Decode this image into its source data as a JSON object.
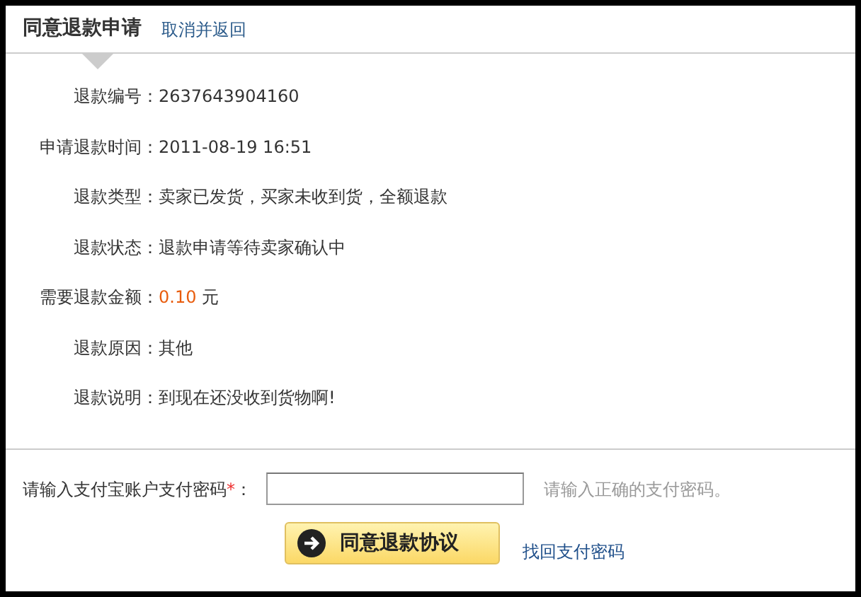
{
  "header": {
    "title": "同意退款申请",
    "link": "取消并返回"
  },
  "details": [
    {
      "label": "退款编号：",
      "value": "2637643904160"
    },
    {
      "label": "申请退款时间：",
      "value": "2011-08-19 16:51"
    },
    {
      "label": "退款类型：",
      "value": "卖家已发货，买家未收到货，全额退款"
    },
    {
      "label": "退款状态：",
      "value": "退款申请等待卖家确认中"
    },
    {
      "label": "需要退款金额：",
      "value": "0.10",
      "unit": "元",
      "kind": "amount"
    },
    {
      "label": "退款原因：",
      "value": "其他"
    },
    {
      "label": "退款说明：",
      "value": "到现在还没收到货物啊!"
    }
  ],
  "password": {
    "label": "请输入支付宝账户支付密码",
    "required_mark": "*",
    "colon": "：",
    "hint": "请输入正确的支付密码。"
  },
  "submit": {
    "label": "同意退款协议"
  },
  "recover_link": "找回支付密码"
}
